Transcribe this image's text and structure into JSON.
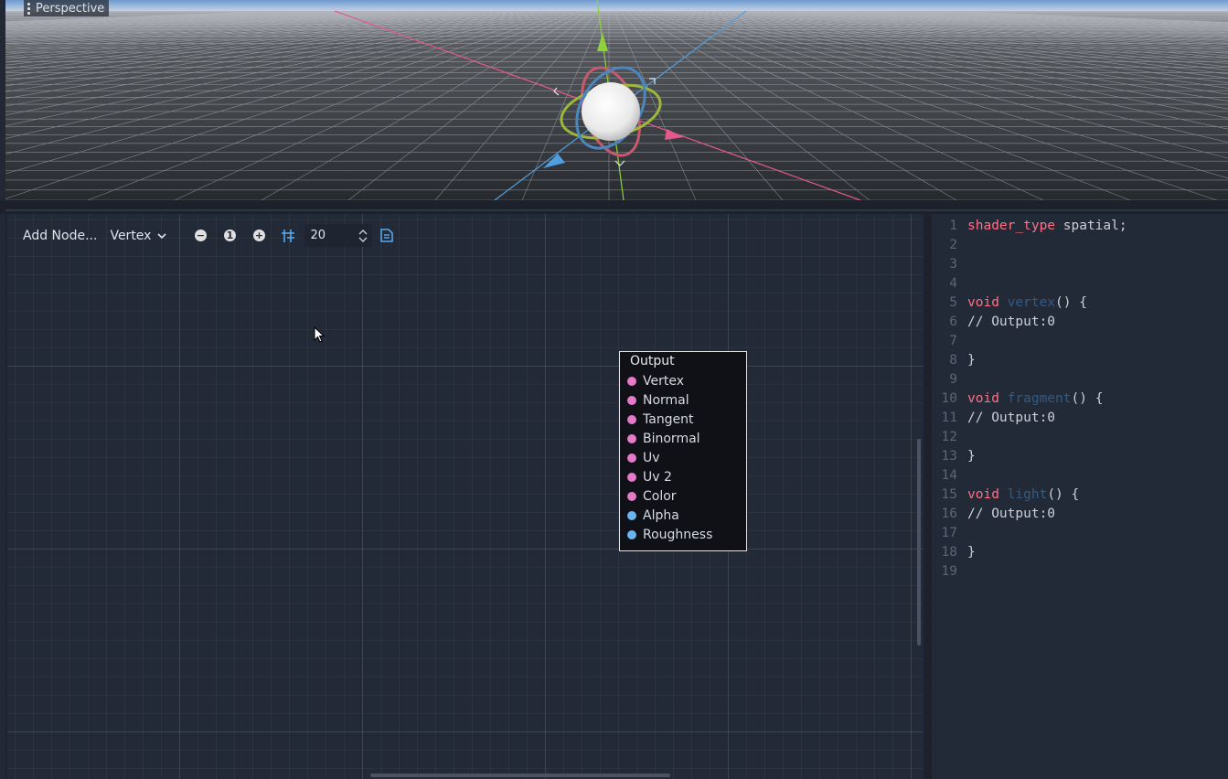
{
  "viewport": {
    "menu_label": "Perspective"
  },
  "graph": {
    "toolbar": {
      "add_node_label": "Add Node...",
      "mode_label": "Vertex",
      "zoom_out_icon": "zoom-out-icon",
      "zoom_reset_icon": "zoom-reset-icon",
      "zoom_in_icon": "zoom-in-icon",
      "snap_icon": "snap-grid-icon",
      "snap_value": "20",
      "show_code_icon": "shader-code-icon"
    },
    "output_node": {
      "title": "Output",
      "ports": [
        {
          "label": "Vertex",
          "color": "#e57ac9"
        },
        {
          "label": "Normal",
          "color": "#e57ac9"
        },
        {
          "label": "Tangent",
          "color": "#e57ac9"
        },
        {
          "label": "Binormal",
          "color": "#e57ac9"
        },
        {
          "label": "Uv",
          "color": "#e57ac9"
        },
        {
          "label": "Uv 2",
          "color": "#e57ac9"
        },
        {
          "label": "Color",
          "color": "#e57ac9"
        },
        {
          "label": "Alpha",
          "color": "#6ab5f0"
        },
        {
          "label": "Roughness",
          "color": "#6ab5f0"
        }
      ]
    }
  },
  "code": {
    "line_numbers": [
      "1",
      "2",
      "3",
      "4",
      "5",
      "6",
      "7",
      "8",
      "9",
      "10",
      "11",
      "12",
      "13",
      "14",
      "15",
      "16",
      "17",
      "18",
      "19"
    ],
    "lines": [
      {
        "kw": "shader_type",
        "rest": " spatial;"
      },
      {
        "text": ""
      },
      {
        "text": ""
      },
      {
        "text": ""
      },
      {
        "kw": "void",
        "fn": "vertex",
        "rest": "() {"
      },
      {
        "text": "// Output:0"
      },
      {
        "text": ""
      },
      {
        "text": "}"
      },
      {
        "text": ""
      },
      {
        "kw": "void",
        "fn": "fragment",
        "rest": "() {"
      },
      {
        "text": "// Output:0"
      },
      {
        "text": ""
      },
      {
        "text": "}"
      },
      {
        "text": ""
      },
      {
        "kw": "void",
        "fn": "light",
        "rest": "() {"
      },
      {
        "text": "// Output:0"
      },
      {
        "text": ""
      },
      {
        "text": "}"
      },
      {
        "text": ""
      }
    ]
  },
  "colors": {
    "keyword": "#ff7085",
    "axis_x": "#e25a8a",
    "axis_y": "#8fd13a",
    "axis_z": "#4f9fe0"
  }
}
